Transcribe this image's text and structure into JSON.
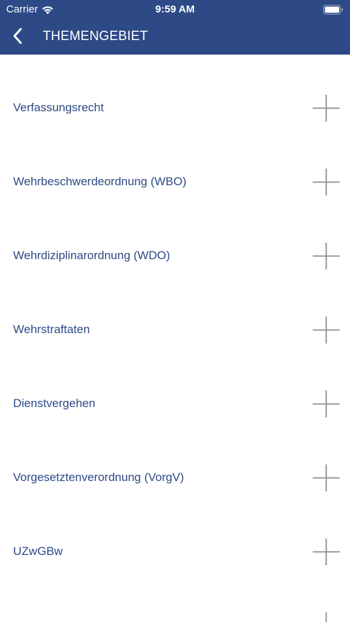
{
  "status_bar": {
    "carrier": "Carrier",
    "time": "9:59 AM"
  },
  "nav": {
    "title": "THEMENGEBIET",
    "back_icon": "chevron-left-icon"
  },
  "colors": {
    "header_bg": "#2d4a86",
    "item_text": "#2d4a86",
    "plus_icon": "#8c8c8c"
  },
  "topics": [
    {
      "label": "Verfassungsrecht",
      "icon": "plus-icon"
    },
    {
      "label": "Wehrbeschwerdeordnung (WBO)",
      "icon": "plus-icon"
    },
    {
      "label": "Wehrdiziplinarordnung (WDO)",
      "icon": "plus-icon"
    },
    {
      "label": "Wehrstraftaten",
      "icon": "plus-icon"
    },
    {
      "label": "Dienstvergehen",
      "icon": "plus-icon"
    },
    {
      "label": "Vorgesetztenverordnung (VorgV)",
      "icon": "plus-icon"
    },
    {
      "label": "UZwGBw",
      "icon": "plus-icon"
    },
    {
      "label": "",
      "icon": "plus-icon"
    }
  ]
}
